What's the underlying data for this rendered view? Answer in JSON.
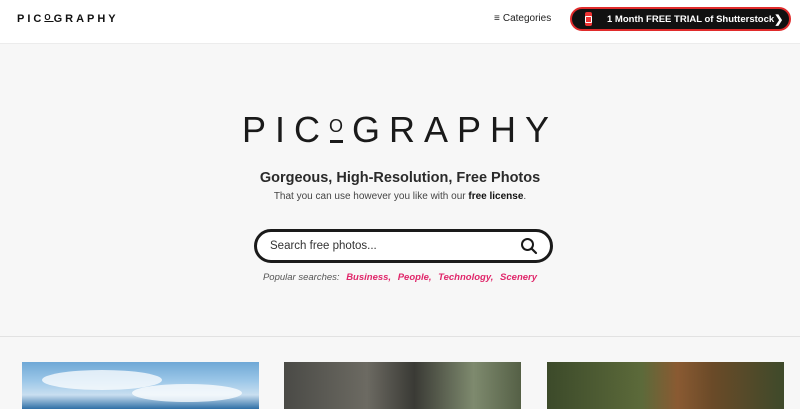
{
  "header": {
    "logo_text": "PICOGRAPHY",
    "categories_label": "Categories",
    "trial_label": "1 Month FREE TRIAL of Shutterstock"
  },
  "hero": {
    "logo_text_pre": "PIC",
    "logo_text_o": "O",
    "logo_text_post": "GRAPHY",
    "tagline": "Gorgeous, High-Resolution, Free Photos",
    "subline_prefix": "That you can use however you like with our ",
    "subline_link": "free license",
    "subline_suffix": ".",
    "search_placeholder": "Search free photos...",
    "popular_label": "Popular searches:",
    "popular_tags": [
      "Business,",
      "People,",
      "Technology,",
      "Scenery"
    ]
  },
  "thumbnails": [
    {
      "subject": "sky-clouds"
    },
    {
      "subject": "woman-interior"
    },
    {
      "subject": "hawk"
    }
  ],
  "colors": {
    "accent_pink": "#e0266a",
    "trial_border": "#e02b2b",
    "dark": "#111111"
  },
  "icons": {
    "menu": "hamburger-icon",
    "search": "search-icon",
    "chevron": "chevron-right-icon",
    "shutterstock": "shutterstock-logo-icon"
  }
}
